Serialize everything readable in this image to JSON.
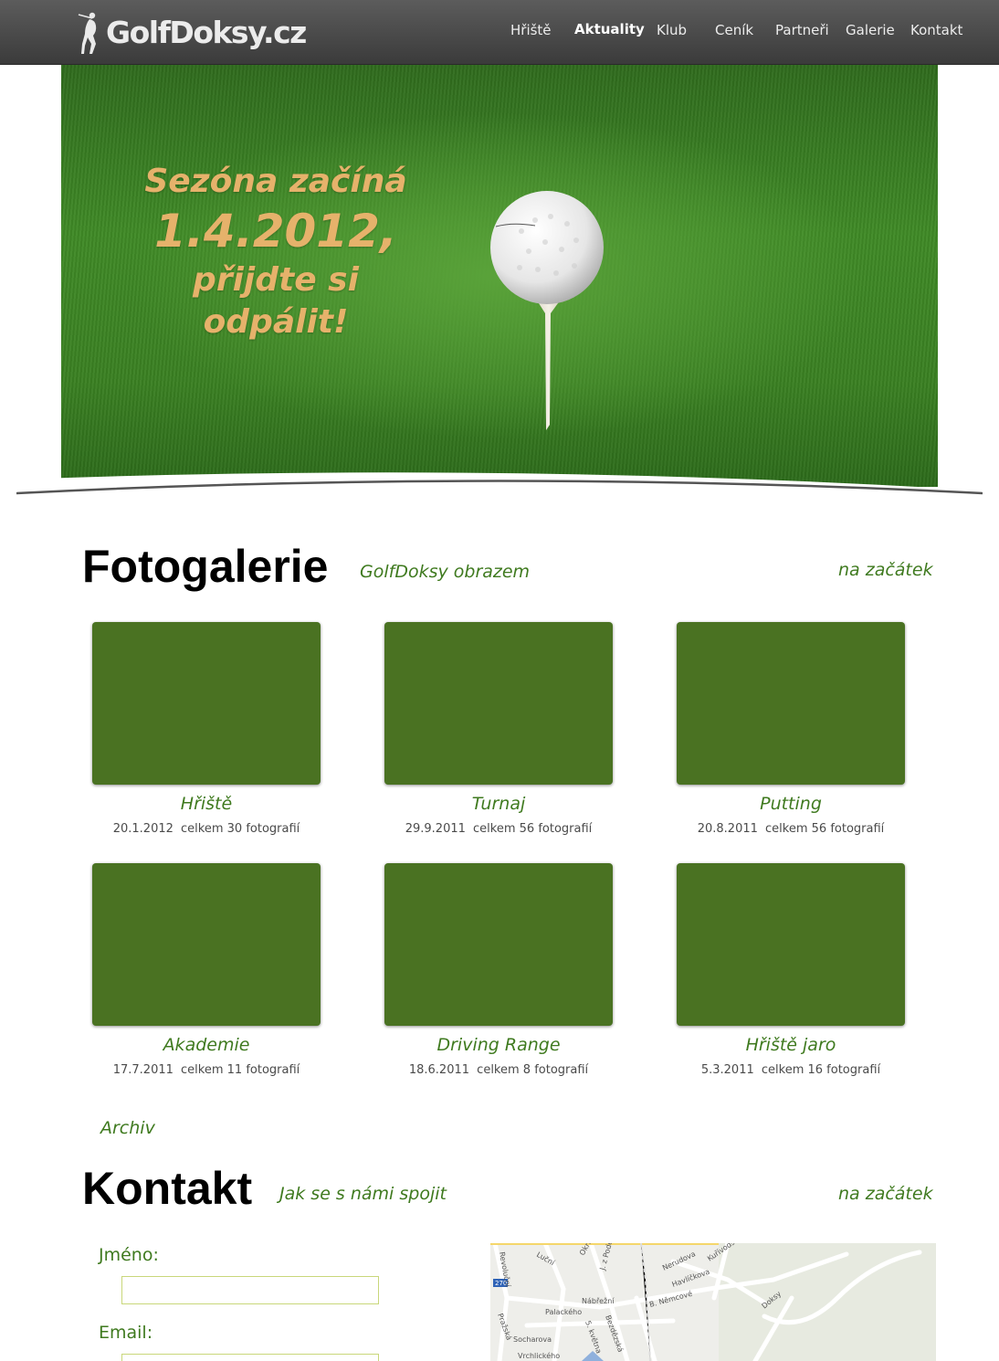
{
  "header": {
    "logo_text": "GolfDoksy.cz",
    "nav": [
      {
        "label": "Hřiště",
        "active": false
      },
      {
        "label": "Aktuality",
        "active": true
      },
      {
        "label": "Klub",
        "active": false
      },
      {
        "label": "Ceník",
        "active": false
      },
      {
        "label": "Partneři",
        "active": false
      },
      {
        "label": "Galerie",
        "active": false
      },
      {
        "label": "Kontakt",
        "active": false
      }
    ]
  },
  "hero": {
    "line1": "Sezóna začíná",
    "line2": "1.4.2012,",
    "line3": "přijdte si",
    "line4": "odpálit!"
  },
  "gallery": {
    "title": "Fotogalerie",
    "subtitle": "GolfDoksy obrazem",
    "to_top": "na začátek",
    "items": [
      {
        "title": "Hřiště",
        "date": "20.1.2012",
        "count": "celkem 30 fotografií"
      },
      {
        "title": "Turnaj",
        "date": "29.9.2011",
        "count": "celkem 56 fotografií"
      },
      {
        "title": "Putting",
        "date": "20.8.2011",
        "count": "celkem 56 fotografií"
      },
      {
        "title": "Akademie",
        "date": "17.7.2011",
        "count": "celkem 11 fotografií"
      },
      {
        "title": "Driving Range",
        "date": "18.6.2011",
        "count": "celkem 8 fotografií"
      },
      {
        "title": "Hřiště jaro",
        "date": "5.3.2011",
        "count": "celkem 16 fotografií"
      }
    ],
    "archive": "Archiv"
  },
  "contact": {
    "title": "Kontakt",
    "subtitle": "Jak se s námi spojit",
    "to_top": "na začátek",
    "name_label": "Jméno:",
    "name_value": "",
    "email_label": "Email:",
    "email_value": ""
  },
  "map": {
    "labels": [
      "Luční",
      "Okružní",
      "J. z Poděbrad",
      "Nerudova",
      "Havlíčkova",
      "Kuřívodská",
      "B. Němcové",
      "Palackého",
      "Nábřežní",
      "Pražská",
      "Socharova",
      "Doksy",
      "Revoluční",
      "Vrchlického",
      "Bezdězská",
      "5. května"
    ],
    "road_number": "270"
  },
  "colors": {
    "accent_green": "#3f7a1f",
    "thumb_green": "#4a7222",
    "hero_text": "#e6b26b",
    "header_bg": "#4a4a4a"
  }
}
